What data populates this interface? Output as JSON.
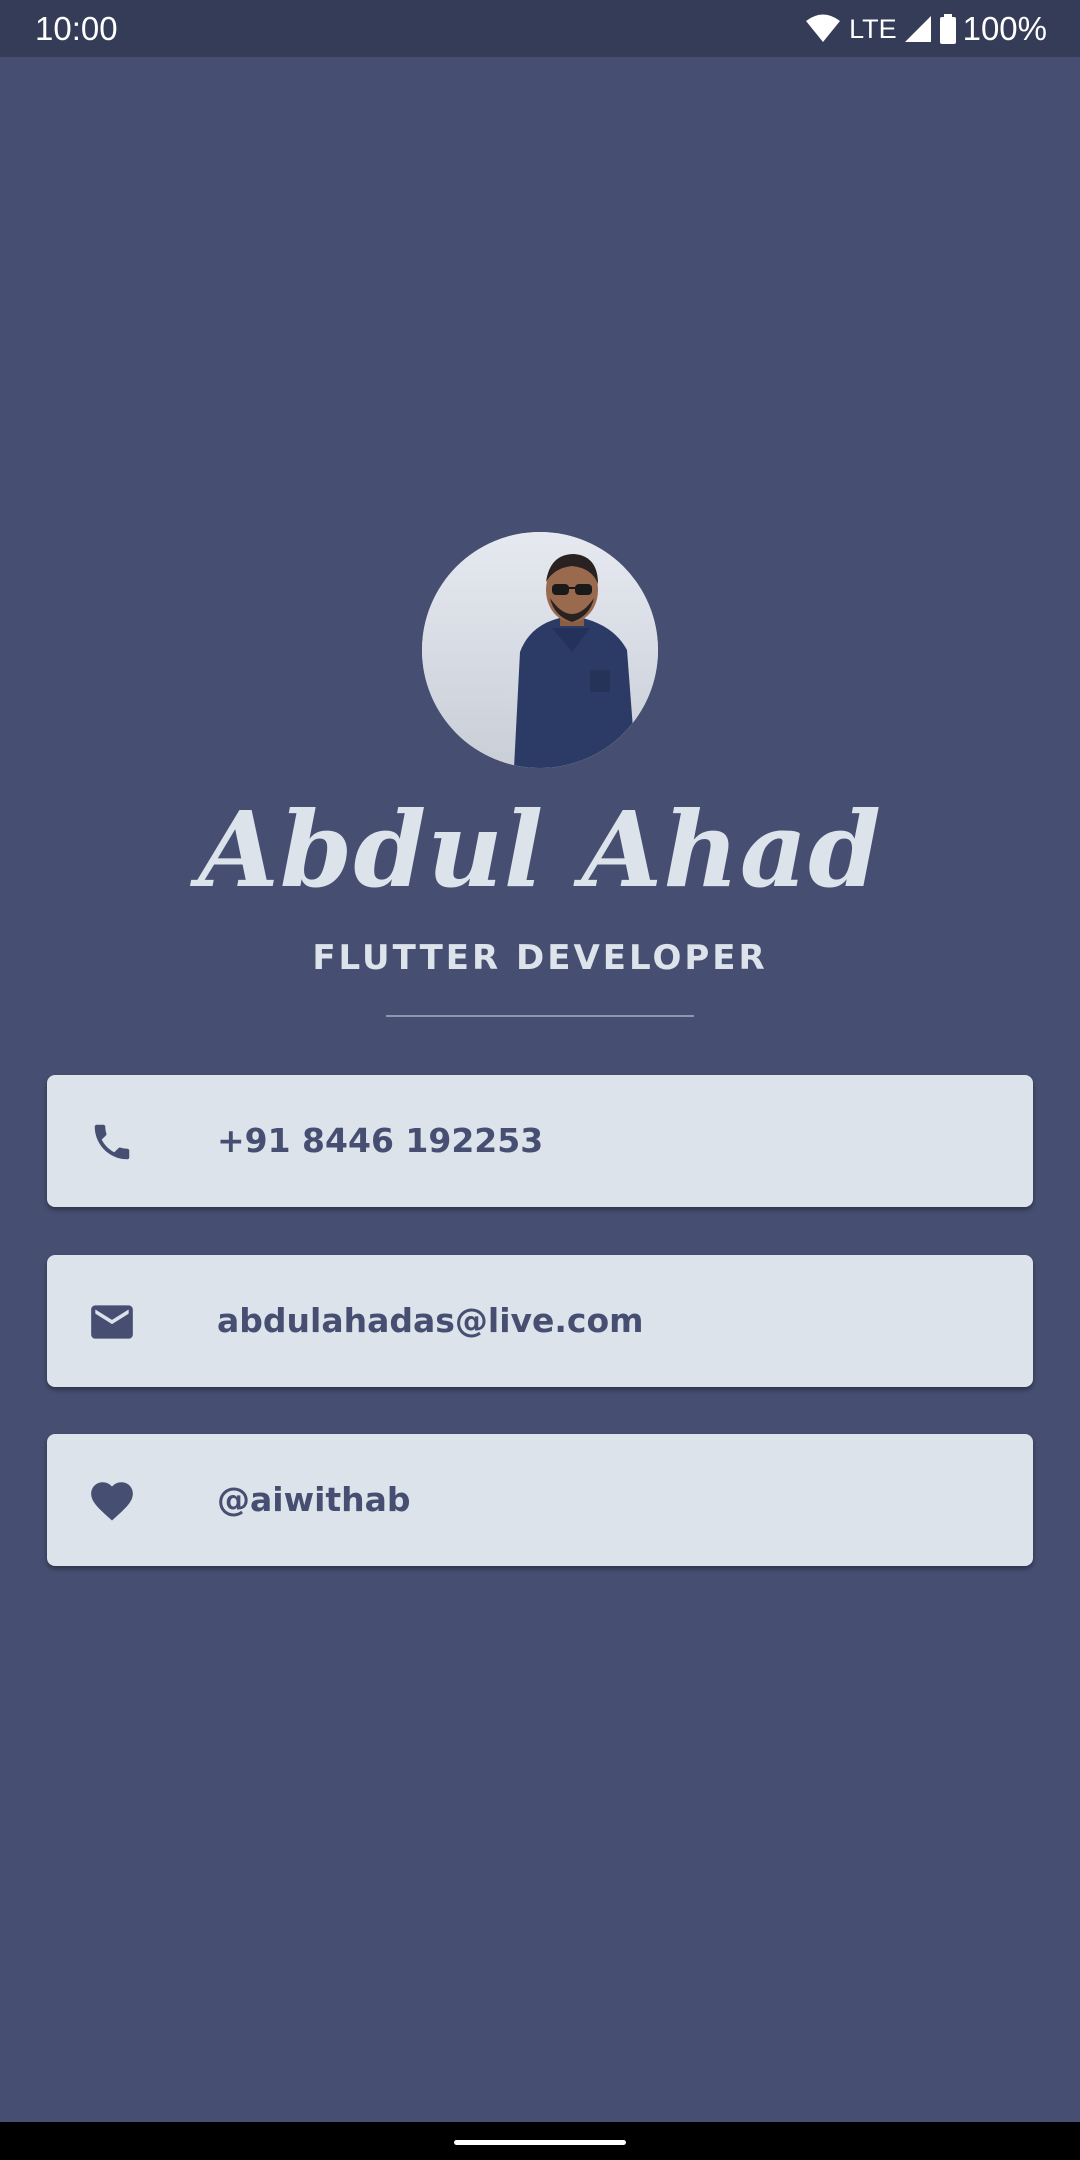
{
  "status_bar": {
    "time": "10:00",
    "network": "LTE",
    "battery": "100%",
    "icons": [
      "wifi-icon",
      "signal-icon",
      "battery-icon"
    ]
  },
  "profile": {
    "name": "Abdul Ahad",
    "role": "FLUTTER DEVELOPER"
  },
  "contacts": [
    {
      "icon": "phone-icon",
      "label": "+91 8446 192253"
    },
    {
      "icon": "mail-icon",
      "label": "abdulahadas@live.com"
    },
    {
      "icon": "heart-icon",
      "label": "@aiwithab"
    }
  ],
  "colors": {
    "background": "#464f72",
    "status_bar": "#353c58",
    "card": "#dde3ea",
    "accent_text": "#464f72",
    "light_text": "#dde3ea"
  }
}
